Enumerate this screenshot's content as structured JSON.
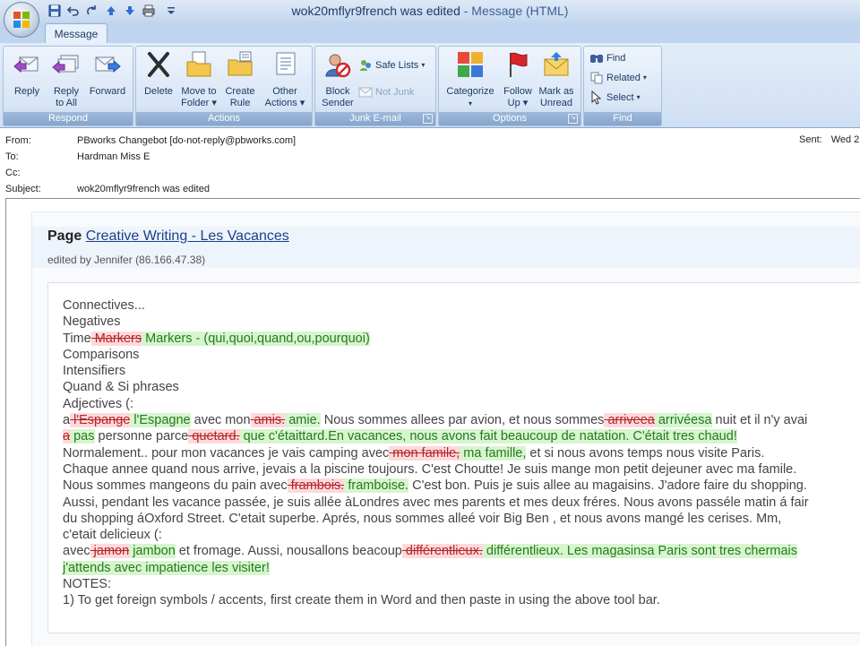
{
  "window": {
    "title": "wok20mflyr9french was edited",
    "app_suffix": " - Message (HTML)"
  },
  "qat": {
    "save_icon": "save-icon",
    "undo_icon": "undo-icon",
    "redo_icon": "redo-icon",
    "prev_icon": "up-arrow-icon",
    "next_icon": "down-arrow-icon",
    "print_icon": "print-icon",
    "customize_icon": "dropdown-icon"
  },
  "tabs": {
    "message": "Message"
  },
  "ribbon": {
    "respond": {
      "label": "Respond",
      "reply": "Reply",
      "reply_all_1": "Reply",
      "reply_all_2": "to All",
      "forward": "Forward"
    },
    "actions": {
      "label": "Actions",
      "delete": "Delete",
      "move_1": "Move to",
      "move_2": "Folder",
      "create_1": "Create",
      "create_2": "Rule",
      "other_1": "Other",
      "other_2": "Actions"
    },
    "junk": {
      "label": "Junk E-mail",
      "block_1": "Block",
      "block_2": "Sender",
      "safe_lists": "Safe Lists",
      "not_junk": "Not Junk"
    },
    "options": {
      "label": "Options",
      "categorize": "Categorize",
      "follow_1": "Follow",
      "follow_2": "Up",
      "mark_1": "Mark as",
      "mark_2": "Unread"
    },
    "find": {
      "label": "Find",
      "find": "Find",
      "related": "Related",
      "select": "Select"
    }
  },
  "header": {
    "from_label": "From:",
    "from_value": "PBworks Changebot [do-not-reply@pbworks.com]",
    "to_label": "To:",
    "to_value": "Hardman Miss E",
    "cc_label": "Cc:",
    "cc_value": "",
    "subject_label": "Subject:",
    "subject_value": "wok20mflyr9french was edited",
    "sent_label": "Sent:",
    "sent_value": "Wed 2"
  },
  "email": {
    "page_prefix": "Page",
    "page_link": "Creative Writing - Les Vacances",
    "edited_by": "edited by Jennifer (86.166.47.38)",
    "lines": [
      [
        {
          "t": "n",
          "s": "Connectives..."
        }
      ],
      [
        {
          "t": "n",
          "s": "Negatives"
        }
      ],
      [
        {
          "t": "n",
          "s": "Time"
        },
        {
          "t": "d",
          "s": " Markers"
        },
        {
          "t": "i",
          "s": " Markers - (qui,quoi,quand,ou,pourquoi)"
        }
      ],
      [
        {
          "t": "n",
          "s": "Comparisons"
        }
      ],
      [
        {
          "t": "n",
          "s": "Intensifiers"
        }
      ],
      [
        {
          "t": "n",
          "s": "Quand & Si phrases"
        }
      ],
      [
        {
          "t": "n",
          "s": "Adjectives (:"
        }
      ],
      [
        {
          "t": "n",
          "s": "a"
        },
        {
          "t": "d",
          "s": " l'Espange"
        },
        {
          "t": "i",
          "s": " l'Espagne"
        },
        {
          "t": "n",
          "s": " avec mon"
        },
        {
          "t": "d",
          "s": " amis."
        },
        {
          "t": "i",
          "s": " amie."
        },
        {
          "t": "n",
          "s": " Nous sommes allees par avion, et nous sommes"
        },
        {
          "t": "d",
          "s": " arriveea"
        },
        {
          "t": "i",
          "s": " arrivéesa"
        },
        {
          "t": "n",
          "s": " nuit et il n'y avai"
        }
      ],
      [
        {
          "t": "d",
          "s": "a"
        },
        {
          "t": "i",
          "s": " pas"
        },
        {
          "t": "n",
          "s": " personne parce"
        },
        {
          "t": "d",
          "s": " quetard."
        },
        {
          "t": "i",
          "s": " que c'étaittard.En vacances, nous avons fait beaucoup de natation. C'était tres chaud!"
        }
      ],
      [
        {
          "t": "n",
          "s": "Normalement.. pour mon vacances je vais camping avec"
        },
        {
          "t": "d",
          "s": " mon famile,"
        },
        {
          "t": "i",
          "s": " ma famille,"
        },
        {
          "t": "n",
          "s": " et si nous avons temps nous visite Paris."
        }
      ],
      [
        {
          "t": "n",
          "s": "Chaque annee quand nous arrive, jevais a la piscine toujours. C'est Choutte! Je suis mange mon petit dejeuner avec ma famile."
        }
      ],
      [
        {
          "t": "n",
          "s": "Nous sommes mangeons du pain avec"
        },
        {
          "t": "d",
          "s": " frambois."
        },
        {
          "t": "i",
          "s": " framboise."
        },
        {
          "t": "n",
          "s": " C'est bon. Puis je suis allee au magaisins. J'adore faire du shopping."
        }
      ],
      [
        {
          "t": "n",
          "s": "Aussi, pendant les vacance passée, je suis allée àLondres avec mes parents et mes deux fréres. Nous avons passéle matin á fair"
        }
      ],
      [
        {
          "t": "n",
          "s": "du shopping áOxford Street. C'etait superbe. Aprés, nous sommes alleé voir Big Ben , et nous avons mangé les cerises. Mm,"
        }
      ],
      [
        {
          "t": "n",
          "s": "c'etait delicieux (:"
        }
      ],
      [
        {
          "t": "n",
          "s": "avec"
        },
        {
          "t": "d",
          "s": " jamon"
        },
        {
          "t": "i",
          "s": " jambon"
        },
        {
          "t": "n",
          "s": " et fromage. Aussi, nousallons beacoup"
        },
        {
          "t": "d",
          "s": " différentlieux."
        },
        {
          "t": "i",
          "s": " différentlieux. Les magasinsa Paris sont tres chermais"
        }
      ],
      [
        {
          "t": "i",
          "s": "j'attends avec impatience les visiter!"
        }
      ],
      [
        {
          "t": "n",
          "s": "NOTES:"
        }
      ],
      [
        {
          "t": "n",
          "s": "1) To get foreign symbols / accents, first create them in Word and then paste in using the above tool bar."
        }
      ]
    ]
  },
  "colors": {
    "deleted_bg": "#ffd9dc",
    "deleted_text": "#b32424",
    "inserted_bg": "#d7f5cf",
    "inserted_text": "#247a1c",
    "link": "#1d3f86"
  }
}
